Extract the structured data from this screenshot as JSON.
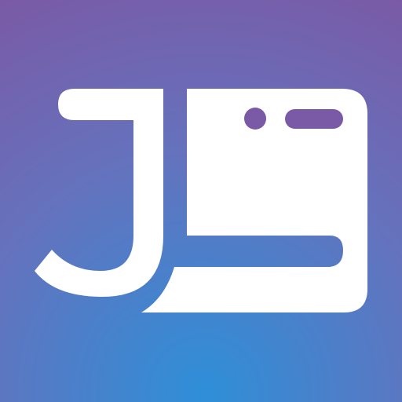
{
  "icon": {
    "name": "app-logo-icon",
    "colors": {
      "background_top": "#7a5aa6",
      "background_glow": "#2e8fd8",
      "foreground": "#ffffff"
    }
  }
}
